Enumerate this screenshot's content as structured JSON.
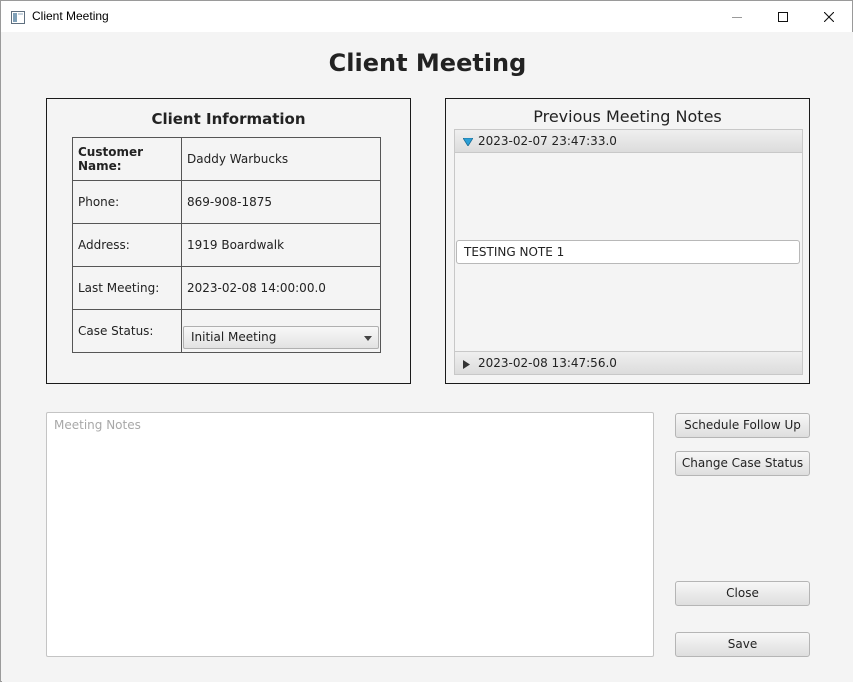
{
  "window": {
    "title": "Client Meeting"
  },
  "page": {
    "title": "Client Meeting"
  },
  "client_info": {
    "title": "Client Information",
    "rows": [
      {
        "label": "Customer Name:",
        "value": "Daddy Warbucks"
      },
      {
        "label": "Phone:",
        "value": "869-908-1875"
      },
      {
        "label": "Address:",
        "value": "1919 Boardwalk"
      },
      {
        "label": "Last Meeting:",
        "value": "2023-02-08 14:00:00.0"
      },
      {
        "label": "Case Status:",
        "value": "Initial Meeting"
      }
    ]
  },
  "previous_notes": {
    "title": "Previous Meeting Notes",
    "entries": [
      {
        "date": "2023-02-07 23:47:33.0",
        "expanded": true,
        "note": "TESTING NOTE 1"
      },
      {
        "date": "2023-02-08 13:47:56.0",
        "expanded": false
      }
    ]
  },
  "meeting_notes": {
    "placeholder": "Meeting Notes",
    "value": ""
  },
  "buttons": {
    "schedule_follow_up": "Schedule Follow Up",
    "change_case_status": "Change Case Status",
    "close": "Close",
    "save": "Save"
  },
  "colors": {
    "accent": "#2a9fd6",
    "background": "#f4f4f4"
  }
}
